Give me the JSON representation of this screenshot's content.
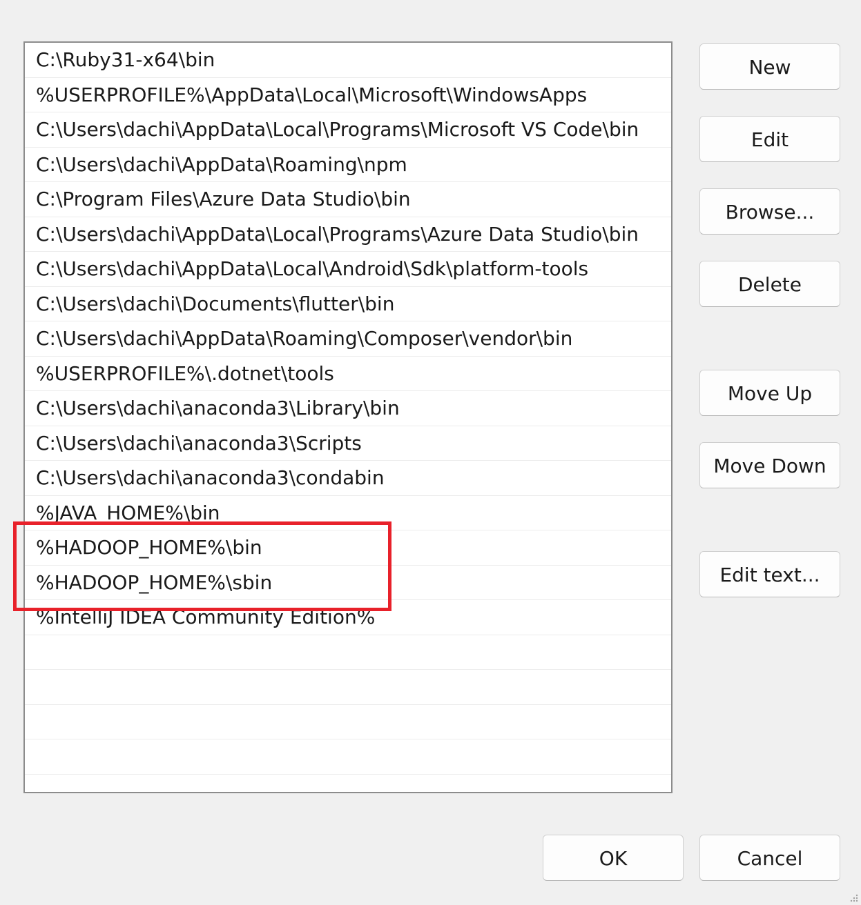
{
  "path_list": {
    "items": [
      "C:\\Ruby31-x64\\bin",
      "%USERPROFILE%\\AppData\\Local\\Microsoft\\WindowsApps",
      "C:\\Users\\dachi\\AppData\\Local\\Programs\\Microsoft VS Code\\bin",
      "C:\\Users\\dachi\\AppData\\Roaming\\npm",
      "C:\\Program Files\\Azure Data Studio\\bin",
      "C:\\Users\\dachi\\AppData\\Local\\Programs\\Azure Data Studio\\bin",
      "C:\\Users\\dachi\\AppData\\Local\\Android\\Sdk\\platform-tools",
      "C:\\Users\\dachi\\Documents\\flutter\\bin",
      "C:\\Users\\dachi\\AppData\\Roaming\\Composer\\vendor\\bin",
      "%USERPROFILE%\\.dotnet\\tools",
      "C:\\Users\\dachi\\anaconda3\\Library\\bin",
      "C:\\Users\\dachi\\anaconda3\\Scripts",
      "C:\\Users\\dachi\\anaconda3\\condabin",
      "%JAVA_HOME%\\bin",
      "%HADOOP_HOME%\\bin",
      "%HADOOP_HOME%\\sbin",
      "%IntelliJ IDEA Community Edition%"
    ],
    "empty_rows": 5
  },
  "buttons": {
    "new": "New",
    "edit": "Edit",
    "browse": "Browse...",
    "delete": "Delete",
    "move_up": "Move Up",
    "move_down": "Move Down",
    "edit_text": "Edit text...",
    "ok": "OK",
    "cancel": "Cancel"
  },
  "colors": {
    "highlight": "#e8212a",
    "background": "#f0f0f0"
  }
}
